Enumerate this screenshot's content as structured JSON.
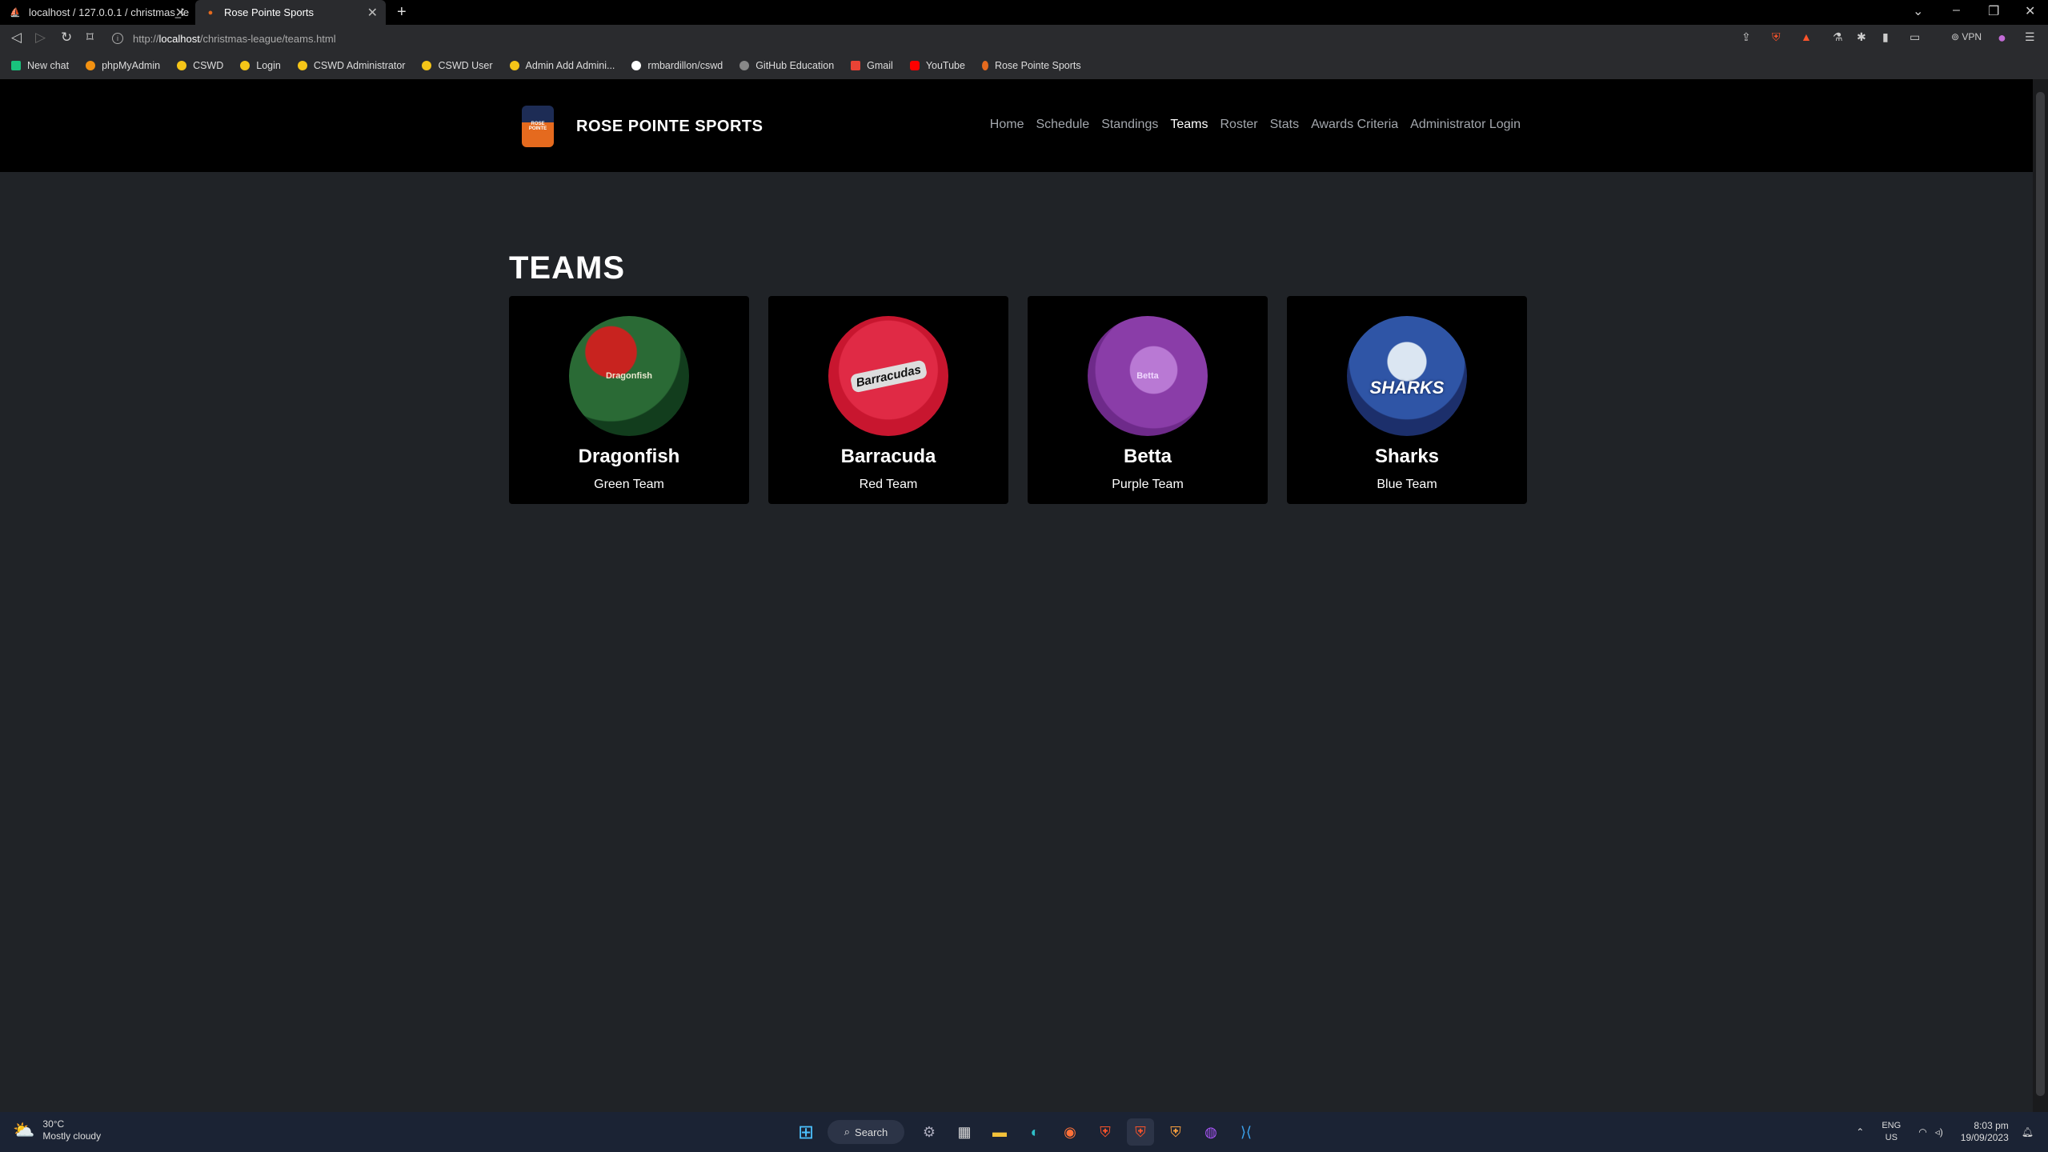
{
  "browser": {
    "tabs": [
      {
        "title": "localhost / 127.0.0.1 / christmas_le"
      },
      {
        "title": "Rose Pointe Sports"
      }
    ],
    "url_prefix": "http://",
    "url_host": "localhost",
    "url_path": "/christmas-league/teams.html",
    "vpn_label": "VPN",
    "bookmarks": [
      {
        "label": "New chat",
        "color": "#19c37d"
      },
      {
        "label": "phpMyAdmin",
        "color": "#f29111"
      },
      {
        "label": "CSWD",
        "color": "#f5c518"
      },
      {
        "label": "Login",
        "color": "#f5c518"
      },
      {
        "label": "CSWD Administrator",
        "color": "#f5c518"
      },
      {
        "label": "CSWD User",
        "color": "#f5c518"
      },
      {
        "label": "Admin Add Admini...",
        "color": "#f5c518"
      },
      {
        "label": "rmbardillon/cswd",
        "color": "#ffffff"
      },
      {
        "label": "GitHub Education",
        "color": "#888888"
      },
      {
        "label": "Gmail",
        "color": "#ea4335"
      },
      {
        "label": "YouTube",
        "color": "#ff0000"
      },
      {
        "label": "Rose Pointe Sports",
        "color": "#e56a1e"
      }
    ]
  },
  "site": {
    "brand": "ROSE POINTE SPORTS",
    "logo_text": "ROSE POINTE",
    "nav": [
      {
        "label": "Home"
      },
      {
        "label": "Schedule"
      },
      {
        "label": "Standings"
      },
      {
        "label": "Teams"
      },
      {
        "label": "Roster"
      },
      {
        "label": "Stats"
      },
      {
        "label": "Awards Criteria"
      },
      {
        "label": "Administrator Login"
      }
    ],
    "active_nav": "Teams"
  },
  "page": {
    "title": "TEAMS",
    "teams": [
      {
        "name": "Dragonfish",
        "team": "Green Team",
        "crest_color": "#1f5a2a",
        "crest_label": "Dragonfish"
      },
      {
        "name": "Barracuda",
        "team": "Red Team",
        "crest_color": "#d81e3a",
        "crest_label": "Barracudas"
      },
      {
        "name": "Betta",
        "team": "Purple Team",
        "crest_color": "#7a3192",
        "crest_label": "Betta"
      },
      {
        "name": "Sharks",
        "team": "Blue Team",
        "crest_color": "#1f3579",
        "crest_label": "SHARKS"
      }
    ]
  },
  "taskbar": {
    "temperature": "30°C",
    "weather": "Mostly cloudy",
    "search_label": "Search",
    "lang_1": "ENG",
    "lang_2": "US",
    "time": "8:03 pm",
    "date": "19/09/2023"
  }
}
